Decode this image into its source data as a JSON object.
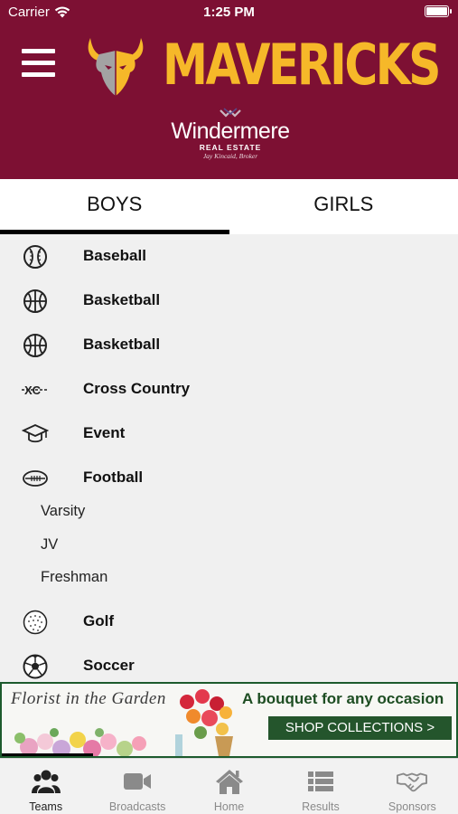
{
  "status_bar": {
    "carrier": "Carrier",
    "time": "1:25 PM"
  },
  "header": {
    "title": "MAVERICKS",
    "sponsor": {
      "name": "Windermere",
      "subtitle": "REAL ESTATE",
      "broker": "Jay Kincaid, Broker"
    }
  },
  "tabs": [
    {
      "label": "BOYS",
      "active": true
    },
    {
      "label": "GIRLS",
      "active": false
    }
  ],
  "sports": [
    {
      "label": "Baseball",
      "icon": "baseball-icon"
    },
    {
      "label": "Basketball",
      "icon": "basketball-icon"
    },
    {
      "label": "Basketball",
      "icon": "basketball-icon"
    },
    {
      "label": "Cross Country",
      "icon": "cross-country-icon",
      "icon_text": "XC"
    },
    {
      "label": "Event",
      "icon": "graduation-cap-icon"
    },
    {
      "label": "Football",
      "icon": "football-icon",
      "sub_items": [
        "Varsity",
        "JV",
        "Freshman"
      ]
    },
    {
      "label": "Golf",
      "icon": "golf-ball-icon"
    },
    {
      "label": "Soccer",
      "icon": "soccer-ball-icon"
    }
  ],
  "ad": {
    "brand": "Florist in the Garden",
    "headline": "A bouquet for any occasion",
    "cta": "SHOP COLLECTIONS >",
    "progress": 0.2
  },
  "bottom_nav": [
    {
      "label": "Teams",
      "icon": "people-icon",
      "active": true
    },
    {
      "label": "Broadcasts",
      "icon": "video-camera-icon",
      "active": false
    },
    {
      "label": "Home",
      "icon": "home-icon",
      "active": false
    },
    {
      "label": "Results",
      "icon": "list-icon",
      "active": false
    },
    {
      "label": "Sponsors",
      "icon": "handshake-icon",
      "active": false
    }
  ],
  "colors": {
    "brand": "#7d1033",
    "accent": "#f6b829",
    "ad_green": "#24552c"
  }
}
